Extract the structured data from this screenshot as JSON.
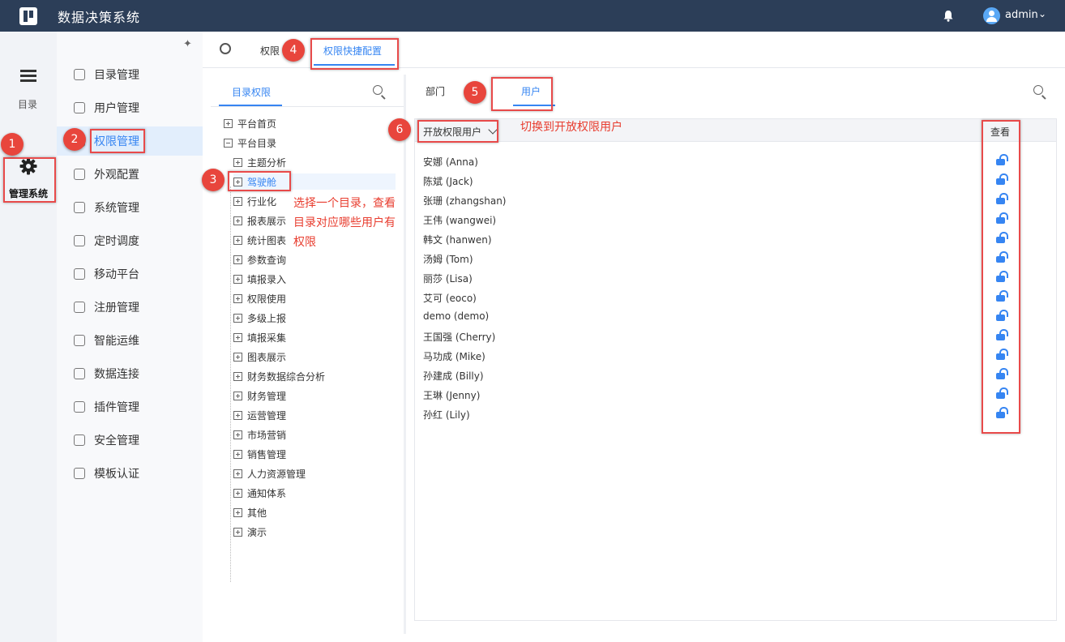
{
  "app": {
    "title": "数据决策系统",
    "user": "admin"
  },
  "rail": {
    "catalog_label": "目录",
    "admin_label": "管理系统"
  },
  "sidebar": {
    "items": [
      {
        "label": "目录管理",
        "icon": "catalog-icon"
      },
      {
        "label": "用户管理",
        "icon": "user-icon"
      },
      {
        "label": "权限管理",
        "icon": "permission-icon"
      },
      {
        "label": "外观配置",
        "icon": "brush-icon"
      },
      {
        "label": "系统管理",
        "icon": "gear-icon"
      },
      {
        "label": "定时调度",
        "icon": "timer-icon"
      },
      {
        "label": "移动平台",
        "icon": "mobile-icon"
      },
      {
        "label": "注册管理",
        "icon": "register-icon"
      },
      {
        "label": "智能运维",
        "icon": "ops-icon"
      },
      {
        "label": "数据连接",
        "icon": "link-icon"
      },
      {
        "label": "插件管理",
        "icon": "plugin-icon"
      },
      {
        "label": "安全管理",
        "icon": "shield-icon"
      },
      {
        "label": "模板认证",
        "icon": "template-icon"
      }
    ],
    "active_index": 2
  },
  "tabs": {
    "tab1": "权限",
    "tab2": "权限快捷配置"
  },
  "left_panel": {
    "tab": "目录权限",
    "tree": [
      {
        "label": "平台首页",
        "expanded": false
      },
      {
        "label": "平台目录",
        "expanded": true
      },
      {
        "label": "主题分析"
      },
      {
        "label": "驾驶舱",
        "selected": true
      },
      {
        "label": "行业化"
      },
      {
        "label": "报表展示"
      },
      {
        "label": "统计图表"
      },
      {
        "label": "参数查询"
      },
      {
        "label": "填报录入"
      },
      {
        "label": "权限使用"
      },
      {
        "label": "多级上报"
      },
      {
        "label": "填报采集"
      },
      {
        "label": "图表展示"
      },
      {
        "label": "财务数据综合分析"
      },
      {
        "label": "财务管理"
      },
      {
        "label": "运营管理"
      },
      {
        "label": "市场营销"
      },
      {
        "label": "销售管理"
      },
      {
        "label": "人力资源管理"
      },
      {
        "label": "通知体系"
      },
      {
        "label": "其他"
      },
      {
        "label": "演示"
      }
    ]
  },
  "right_panel": {
    "tab_dept": "部门",
    "tab_user": "用户",
    "filter": "开放权限用户",
    "col_view": "查看",
    "users": [
      "安娜 (Anna)",
      "陈斌 (Jack)",
      "张珊 (zhangshan)",
      "王伟 (wangwei)",
      "韩文 (hanwen)",
      "汤姆 (Tom)",
      "丽莎 (Lisa)",
      "艾可 (eoco)",
      "demo (demo)",
      "王国强 (Cherry)",
      "马功成 (Mike)",
      "孙建成 (Billy)",
      "王琳 (Jenny)",
      "孙红 (Lily)"
    ]
  },
  "annotations": {
    "badges": [
      "1",
      "2",
      "3",
      "4",
      "5",
      "6"
    ],
    "note_tree": [
      "选择一个目录，查看",
      "目录对应哪些用户有",
      "权限"
    ],
    "note_filter": "切换到开放权限用户"
  },
  "colors": {
    "topbar": "#2c3e58",
    "accent": "#3685f2",
    "annotation": "#e84a4a"
  }
}
